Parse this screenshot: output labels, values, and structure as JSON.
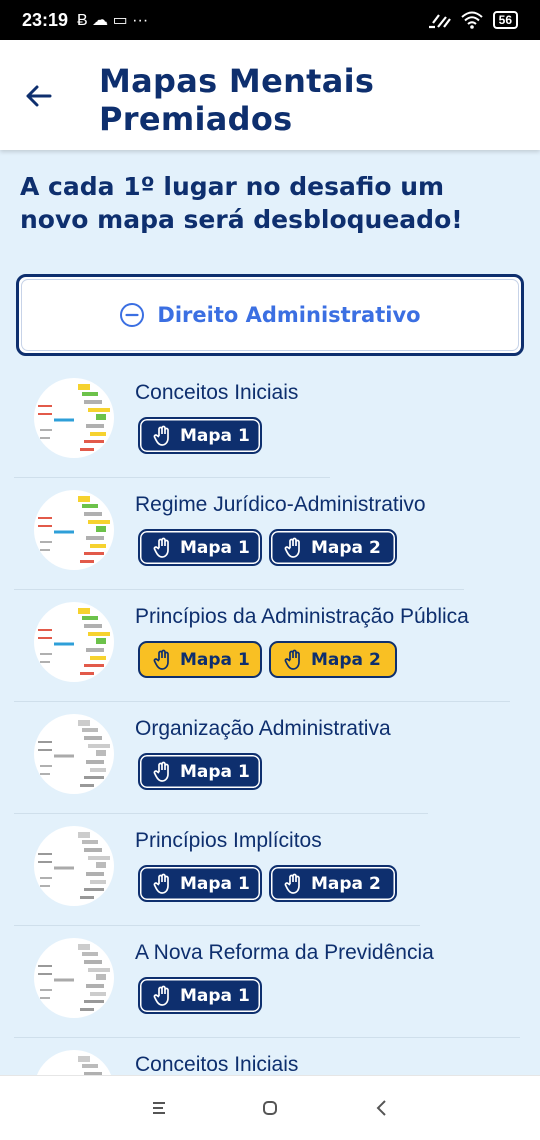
{
  "status_bar": {
    "time": "23:19",
    "extra_icons": "Ƀ ☁ ▭ ···",
    "battery": "56"
  },
  "header": {
    "title": "Mapas Mentais Premiados",
    "back_icon": "arrow-left-icon"
  },
  "intro": "A cada 1º lugar no desafio um novo mapa será desbloqueado!",
  "section": {
    "label": "Direito Administrativo",
    "icon": "minus-circle-icon",
    "expanded": true
  },
  "colors": {
    "primary": "#0e2f6e",
    "accent": "#3b6fe2",
    "gold": "#f9c023",
    "background": "#e3f1fb"
  },
  "items": [
    {
      "title": "Conceitos Iniciais",
      "thumb": "color",
      "maps": [
        {
          "label": "Mapa 1",
          "style": "dark"
        }
      ]
    },
    {
      "title": "Regime Jurídico-Administrativo",
      "thumb": "color",
      "maps": [
        {
          "label": "Mapa 1",
          "style": "dark"
        },
        {
          "label": "Mapa 2",
          "style": "dark"
        }
      ]
    },
    {
      "title": "Princípios da Administração Pública",
      "thumb": "color",
      "maps": [
        {
          "label": "Mapa 1",
          "style": "gold"
        },
        {
          "label": "Mapa 2",
          "style": "gold"
        }
      ]
    },
    {
      "title": "Organização Administrativa",
      "thumb": "gray",
      "maps": [
        {
          "label": "Mapa 1",
          "style": "dark"
        }
      ]
    },
    {
      "title": "Princípios Implícitos",
      "thumb": "gray",
      "maps": [
        {
          "label": "Mapa 1",
          "style": "dark"
        },
        {
          "label": "Mapa 2",
          "style": "dark"
        }
      ]
    },
    {
      "title": "A Nova Reforma da Previdência",
      "thumb": "gray",
      "maps": [
        {
          "label": "Mapa 1",
          "style": "dark"
        }
      ]
    },
    {
      "title": "Conceitos Iniciais",
      "thumb": "gray",
      "maps": []
    }
  ],
  "nav": {
    "menu_icon": "menu-icon",
    "home_icon": "home-icon",
    "back_icon": "back-chevron-icon"
  }
}
